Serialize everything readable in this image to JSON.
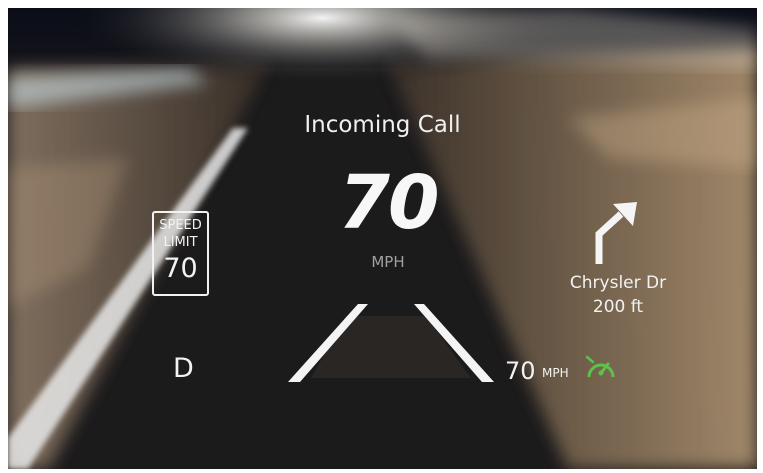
{
  "notification": {
    "text": "Incoming Call"
  },
  "speedometer": {
    "value": "70",
    "unit": "MPH"
  },
  "speed_limit": {
    "line1": "SPEED",
    "line2": "LIMIT",
    "value": "70"
  },
  "transmission": {
    "gear": "D"
  },
  "navigation": {
    "street": "Chrysler Dr",
    "distance": "200 ft",
    "icon": "turn-right-arrow-icon"
  },
  "cruise_control": {
    "value": "70",
    "unit": "MPH",
    "icon": "adaptive-cruise-icon",
    "color": "#4caf50"
  },
  "colors": {
    "hud_text": "#f2f2f2",
    "accent_green": "#5cc24a"
  }
}
